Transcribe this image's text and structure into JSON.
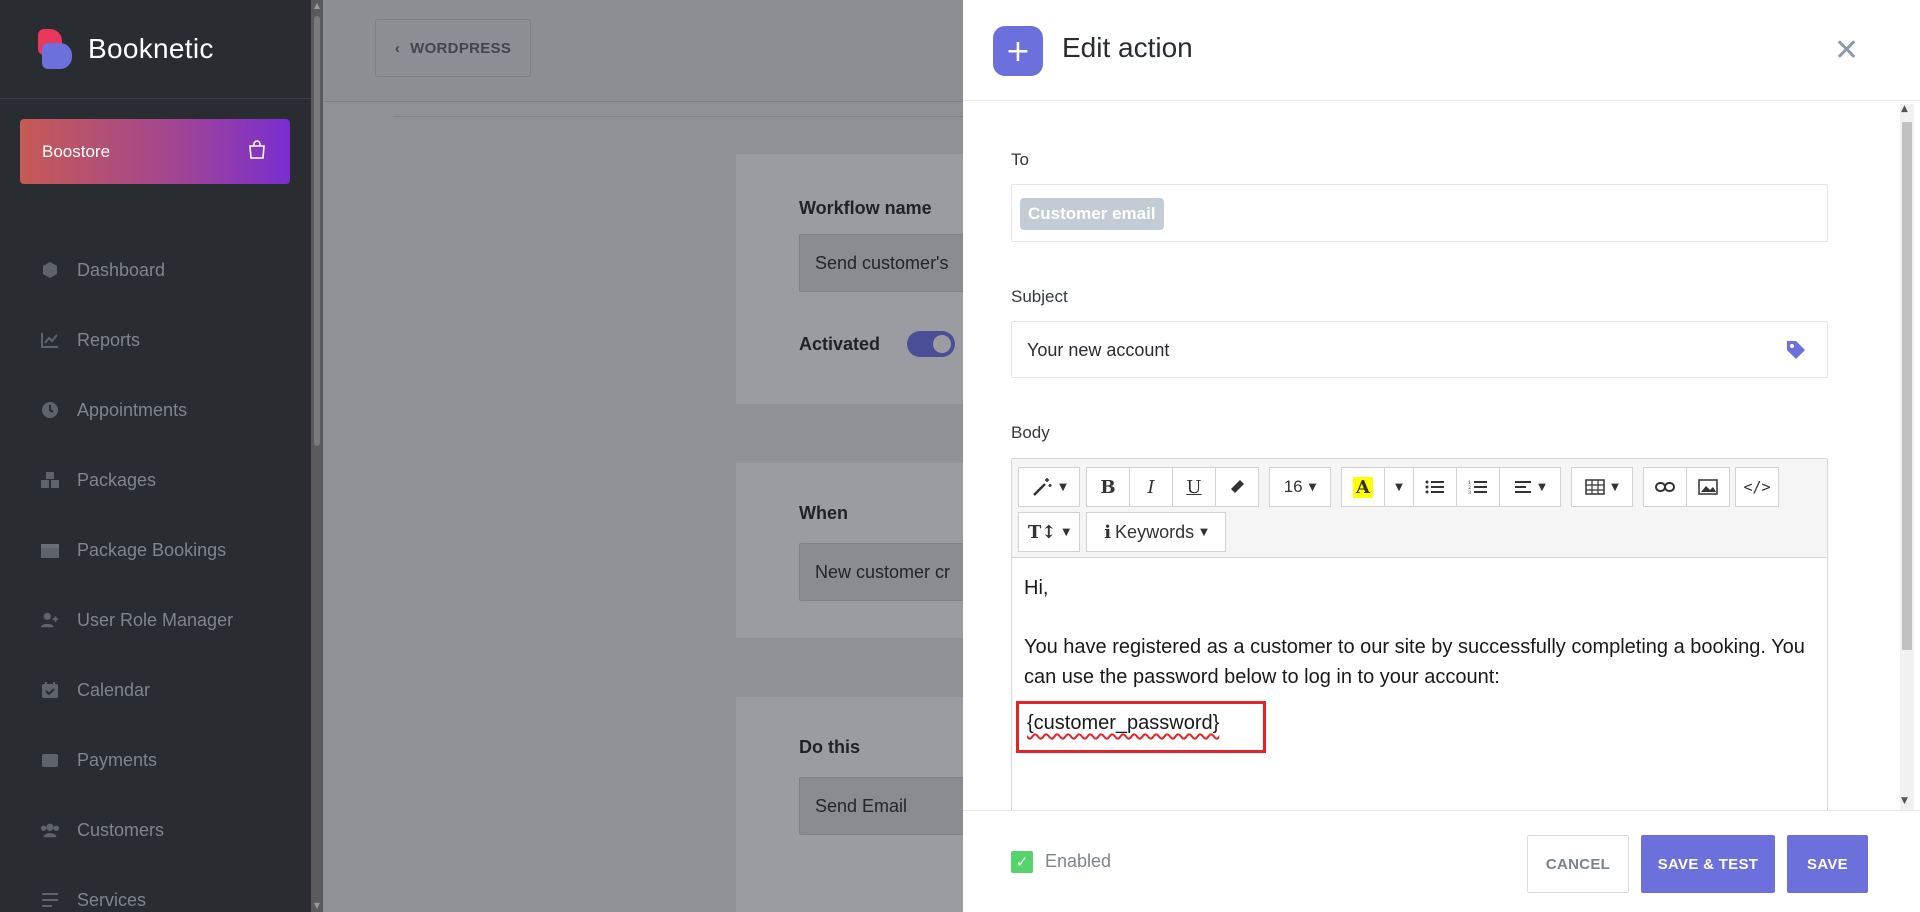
{
  "brand": {
    "name": "Booknetic"
  },
  "boostore": {
    "label": "Boostore",
    "icon": "shopping-bag-icon"
  },
  "sidebar": {
    "items": [
      {
        "label": "Dashboard",
        "icon": "cube-icon"
      },
      {
        "label": "Reports",
        "icon": "chart-line-icon"
      },
      {
        "label": "Appointments",
        "icon": "clock-icon"
      },
      {
        "label": "Packages",
        "icon": "boxes-icon"
      },
      {
        "label": "Package Bookings",
        "icon": "gift-box-icon"
      },
      {
        "label": "User Role Manager",
        "icon": "user-plus-icon"
      },
      {
        "label": "Calendar",
        "icon": "calendar-check-icon"
      },
      {
        "label": "Payments",
        "icon": "wallet-icon"
      },
      {
        "label": "Customers",
        "icon": "users-icon"
      },
      {
        "label": "Services",
        "icon": "list-icon"
      }
    ]
  },
  "topbar": {
    "back_label": "WORDPRESS"
  },
  "workflow": {
    "name_label": "Workflow name",
    "name_value": "Send customer's",
    "activated_label": "Activated",
    "when_label": "When",
    "when_value": "New customer cr",
    "do_label": "Do this",
    "do_value": "Send Email"
  },
  "modal": {
    "title": "Edit action",
    "to_label": "To",
    "to_tag": "Customer email",
    "subject_label": "Subject",
    "subject_value": "Your new account",
    "body_label": "Body",
    "toolbar": {
      "font_size": "16",
      "keywords": "Keywords"
    },
    "body": {
      "line1": "Hi,",
      "line2": "You have registered as a customer to our site by successfully completing a booking. You can use the password below to log in to your account:",
      "password_token": "{customer_password}"
    },
    "footer": {
      "enabled_label": "Enabled",
      "cancel": "CANCEL",
      "save_test": "SAVE & TEST",
      "save": "SAVE"
    }
  },
  "colors": {
    "accent": "#6c70dc",
    "sidebar_bg": "#292d32",
    "highlight": "#e0252c",
    "check": "#53d56c"
  }
}
